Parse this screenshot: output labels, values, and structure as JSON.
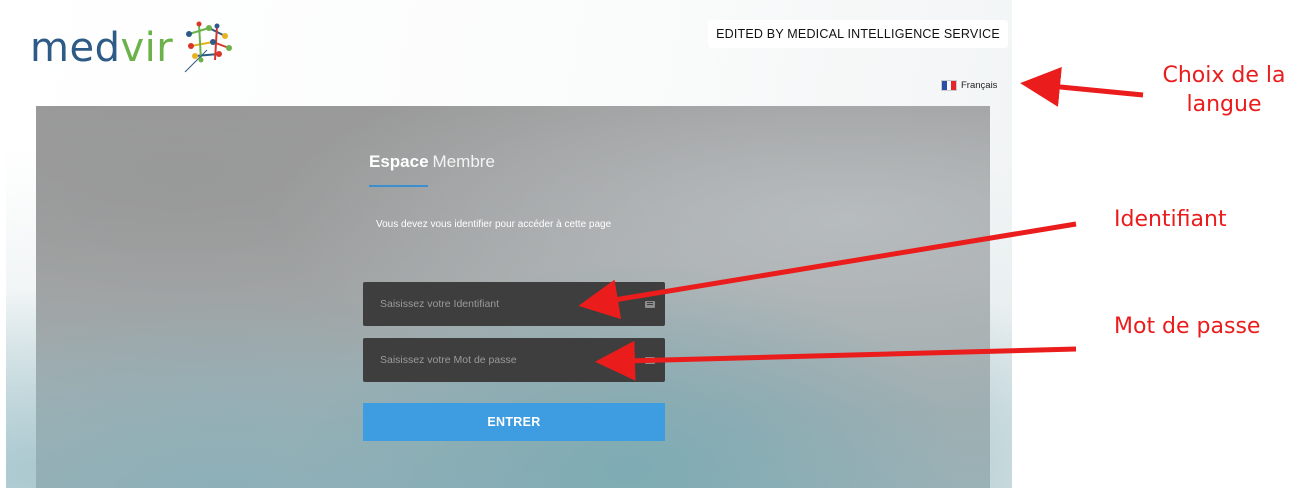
{
  "header": {
    "logo_primary": "med",
    "logo_secondary": "vir",
    "edited_by": "EDITED BY MEDICAL INTELLIGENCE SERVICE",
    "language_label": "Français"
  },
  "login": {
    "title_bold": "Espace",
    "title_light": "Membre",
    "notice": "Vous devez vous identifier pour accéder à cette page",
    "username_placeholder": "Saisissez votre Identifiant",
    "password_placeholder": "Saisissez votre Mot de passe",
    "submit_label": "ENTRER"
  },
  "annotations": {
    "language": "Choix de la langue",
    "username": "Identifiant",
    "password": "Mot de passe"
  },
  "colors": {
    "accent_blue": "#3d9de0",
    "annotation_red": "#ea1c1c",
    "logo_blue": "#2e5a86",
    "logo_green": "#6bb24a"
  },
  "icons": {
    "username_field": "keyboard-icon",
    "password_field": "keyboard-icon",
    "language": "french-flag-icon"
  }
}
